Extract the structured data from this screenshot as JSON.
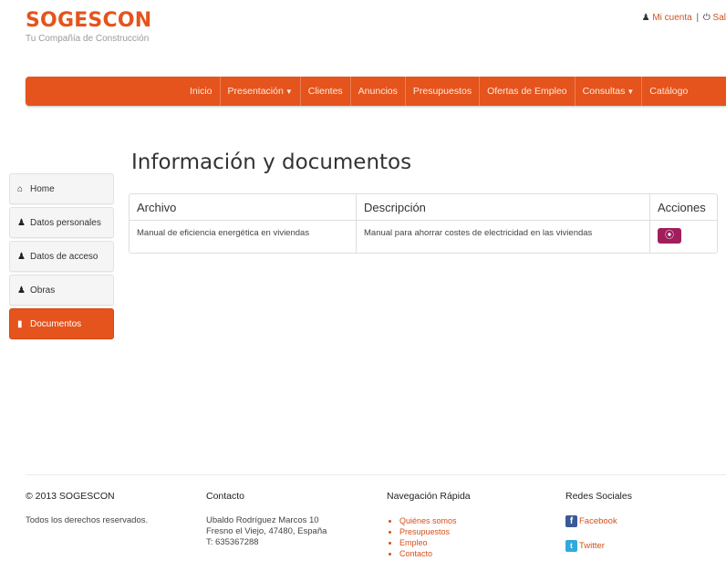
{
  "brand": {
    "title": "SOGESCON",
    "subtitle": "Tu Compañía de Construcción"
  },
  "account": {
    "my_account": "Mi cuenta",
    "separator": "|",
    "logout": "Sal"
  },
  "nav": {
    "items": [
      {
        "label": "Inicio",
        "dropdown": false
      },
      {
        "label": "Presentación",
        "dropdown": true
      },
      {
        "label": "Clientes",
        "dropdown": false
      },
      {
        "label": "Anuncios",
        "dropdown": false
      },
      {
        "label": "Presupuestos",
        "dropdown": false
      },
      {
        "label": "Ofertas de Empleo",
        "dropdown": false
      },
      {
        "label": "Consultas",
        "dropdown": true
      },
      {
        "label": "Catálogo",
        "dropdown": false
      }
    ]
  },
  "page": {
    "title": "Información y documentos"
  },
  "sidebar": {
    "items": [
      {
        "label": "Home",
        "icon": "home-icon",
        "active": false
      },
      {
        "label": "Datos personales",
        "icon": "user-icon",
        "active": false
      },
      {
        "label": "Datos de acceso",
        "icon": "user-icon",
        "active": false
      },
      {
        "label": "Obras",
        "icon": "user-icon",
        "active": false
      },
      {
        "label": "Documentos",
        "icon": "document-icon",
        "active": true
      }
    ]
  },
  "table": {
    "headers": [
      "Archivo",
      "Descripción",
      "Acciones"
    ],
    "rows": [
      {
        "file": "Manual de eficiencia energética en viviendas",
        "description": "Manual para ahorrar costes de electricidad en las viviendas",
        "action_icon": "download-icon"
      }
    ]
  },
  "footer": {
    "copyright": {
      "title": "© 2013 SOGESCON",
      "text": "Todos los derechos reservados."
    },
    "contact": {
      "title": "Contacto",
      "lines": [
        "Ubaldo Rodríguez Marcos 10",
        "Fresno el Viejo, 47480, España",
        "T: 635367288"
      ]
    },
    "quick_nav": {
      "title": "Navegación Rápida",
      "links": [
        "Quiénes somos",
        "Presupuestos",
        "Empleo",
        "Contacto"
      ]
    },
    "social": {
      "title": "Redes Sociales",
      "links": [
        {
          "label": "Facebook",
          "icon": "facebook-icon"
        },
        {
          "label": "Twitter",
          "icon": "twitter-icon"
        }
      ]
    }
  },
  "colors": {
    "accent": "#e4541c",
    "action_button": "#a01e5c"
  }
}
